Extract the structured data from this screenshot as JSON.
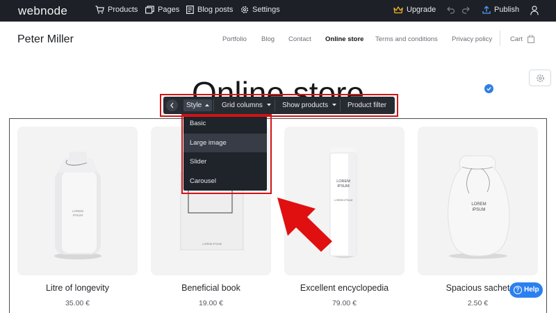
{
  "topbar": {
    "brand": "webnode",
    "products": "Products",
    "pages": "Pages",
    "blog_posts": "Blog posts",
    "settings": "Settings",
    "upgrade": "Upgrade",
    "publish": "Publish"
  },
  "site": {
    "name": "Peter Miller",
    "nav": [
      "Portfolio",
      "Blog",
      "Contact",
      "Online store",
      "Terms and conditions",
      "Privacy policy"
    ],
    "active_nav": "Online store",
    "cart": "Cart"
  },
  "page": {
    "title": "Online store"
  },
  "style_toolbar": {
    "style": "Style",
    "grid_columns": "Grid columns",
    "show_products": "Show products",
    "product_filter": "Product filter"
  },
  "style_menu": {
    "items": [
      "Basic",
      "Large image",
      "Slider",
      "Carousel"
    ],
    "highlighted": "Large image"
  },
  "products": [
    {
      "name": "Litre of longevity",
      "price": "35.00 €",
      "label": [
        "LOREM",
        "IPSUM"
      ]
    },
    {
      "name": "Beneficial book",
      "price": "19.00 €",
      "label": [
        "LOREM IPSUM"
      ]
    },
    {
      "name": "Excellent encyclopedia",
      "price": "79.00 €",
      "label": [
        "LOREM",
        "IPSUM",
        "LOREM IPSUM"
      ]
    },
    {
      "name": "Spacious sachet",
      "price": "2.50 €",
      "label": [
        "LOREM",
        "IPSUM"
      ]
    }
  ],
  "help": {
    "label": "Help",
    "glyph": "?"
  },
  "colors": {
    "topbar": "#1d2026",
    "toolbar": "#262a31",
    "highlight_border": "#d11414",
    "accent_blue": "#2b80f0",
    "upgrade_crown": "#f0b429",
    "arrow": "#e01010"
  },
  "icons": [
    "cart-icon",
    "pages-icon",
    "blog-posts-icon",
    "gear-icon",
    "crown-icon",
    "undo-icon",
    "redo-icon",
    "upload-icon",
    "user-icon",
    "chevron-left-icon",
    "caret-up-icon",
    "caret-down-icon",
    "check-icon",
    "help-icon"
  ]
}
